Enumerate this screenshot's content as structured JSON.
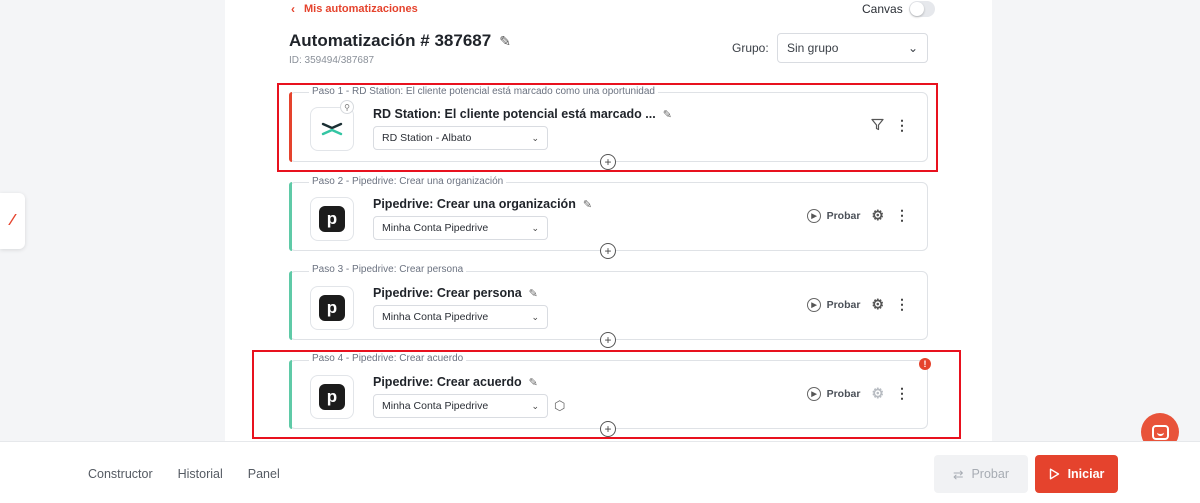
{
  "header": {
    "back_label": "Mis automatizaciones",
    "canvas_label": "Canvas",
    "canvas_enabled": false,
    "title": "Automatización # 387687",
    "id_text": "ID: 359494/387687",
    "group_label": "Grupo:",
    "group_value": "Sin grupo"
  },
  "steps": [
    {
      "caption": "Paso 1 - RD Station: El cliente potencial está marcado como una oportunidad",
      "title": "RD Station: El cliente potencial está marcado ...",
      "account": "RD Station - Albato",
      "app_icon": "rd-station-icon",
      "accent_color": "#e5432d",
      "highlighted": true
    },
    {
      "caption": "Paso 2 - Pipedrive: Crear una organización",
      "title": "Pipedrive: Crear una organización",
      "account": "Minha Conta Pipedrive",
      "app_icon": "pipedrive-icon",
      "logo_letter": "p",
      "accent_color": "#5fcaa7",
      "test_label": "Probar"
    },
    {
      "caption": "Paso 3 - Pipedrive: Crear persona",
      "title": "Pipedrive: Crear persona",
      "account": "Minha Conta Pipedrive",
      "app_icon": "pipedrive-icon",
      "logo_letter": "p",
      "accent_color": "#5fcaa7",
      "test_label": "Probar"
    },
    {
      "caption": "Paso 4 - Pipedrive: Crear acuerdo",
      "title": "Pipedrive: Crear acuerdo",
      "account": "Minha Conta Pipedrive",
      "app_icon": "pipedrive-icon",
      "logo_letter": "p",
      "accent_color": "#5fcaa7",
      "test_label": "Probar",
      "highlighted": true,
      "has_error": true,
      "error_mark": "!"
    }
  ],
  "footer": {
    "tabs": [
      "Constructor",
      "Historial",
      "Panel"
    ],
    "probar_label": "Probar",
    "iniciar_label": "Iniciar"
  },
  "colors": {
    "accent": "#e5432d",
    "success": "#5fcaa7",
    "highlight": "#e8111e"
  }
}
